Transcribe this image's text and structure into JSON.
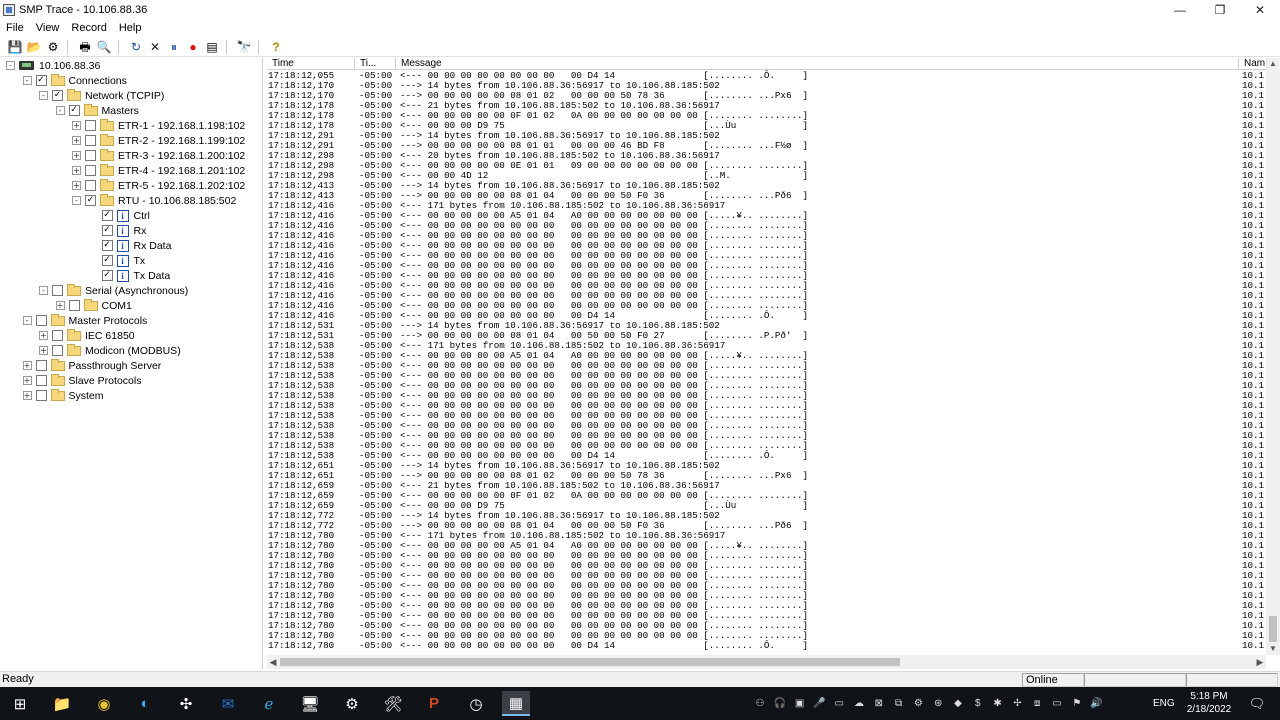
{
  "window": {
    "title": "SMP Trace - 10.106.88.36"
  },
  "menu": [
    "File",
    "View",
    "Record",
    "Help"
  ],
  "toolbar": [
    {
      "name": "save-icon",
      "glyph": "💾"
    },
    {
      "name": "open-icon",
      "glyph": "📂"
    },
    {
      "name": "settings-disabled-icon",
      "glyph": "⚙"
    },
    {
      "sep": true
    },
    {
      "name": "print-icon",
      "glyph": "🖶"
    },
    {
      "name": "print-preview-icon",
      "glyph": "🔍"
    },
    {
      "sep": true
    },
    {
      "name": "refresh-icon",
      "glyph": "↻"
    },
    {
      "name": "clear-icon",
      "glyph": "✕"
    },
    {
      "name": "pause-icon",
      "glyph": "⏸"
    },
    {
      "name": "record-icon",
      "glyph": "●"
    },
    {
      "name": "view-list-icon",
      "glyph": "▤"
    },
    {
      "sep": true
    },
    {
      "name": "find-icon",
      "glyph": "🔭"
    },
    {
      "sep": true
    },
    {
      "name": "help-icon",
      "glyph": "?"
    }
  ],
  "tree": [
    {
      "depth": 0,
      "label": "10.106.88.36",
      "exp": "-",
      "kind": "pc",
      "chk": null
    },
    {
      "depth": 1,
      "label": "Connections",
      "exp": "-",
      "kind": "folder",
      "chk": "✓"
    },
    {
      "depth": 2,
      "label": "Network (TCPIP)",
      "exp": "-",
      "kind": "folder",
      "chk": "✓"
    },
    {
      "depth": 3,
      "label": "Masters",
      "exp": "-",
      "kind": "folder",
      "chk": "✓"
    },
    {
      "depth": 4,
      "label": "ETR-1 - 192.168.1.198:102",
      "exp": "+",
      "kind": "folder",
      "chk": ""
    },
    {
      "depth": 4,
      "label": "ETR-2 - 192.168.1.199:102",
      "exp": "+",
      "kind": "folder",
      "chk": ""
    },
    {
      "depth": 4,
      "label": "ETR-3 - 192.168.1.200:102",
      "exp": "+",
      "kind": "folder",
      "chk": ""
    },
    {
      "depth": 4,
      "label": "ETR-4 - 192.168.1.201:102",
      "exp": "+",
      "kind": "folder",
      "chk": ""
    },
    {
      "depth": 4,
      "label": "ETR-5 - 192.168.1.202:102",
      "exp": "+",
      "kind": "folder",
      "chk": ""
    },
    {
      "depth": 4,
      "label": "RTU - 10.106.88.185:502",
      "exp": "-",
      "kind": "folder",
      "chk": "✓"
    },
    {
      "depth": 5,
      "label": "Ctrl",
      "exp": "",
      "kind": "info",
      "chk": "✓"
    },
    {
      "depth": 5,
      "label": "Rx",
      "exp": "",
      "kind": "info",
      "chk": "✓"
    },
    {
      "depth": 5,
      "label": "Rx Data",
      "exp": "",
      "kind": "info",
      "chk": "✓"
    },
    {
      "depth": 5,
      "label": "Tx",
      "exp": "",
      "kind": "info",
      "chk": "✓"
    },
    {
      "depth": 5,
      "label": "Tx Data",
      "exp": "",
      "kind": "info",
      "chk": "✓"
    },
    {
      "depth": 2,
      "label": "Serial (Asynchronous)",
      "exp": "-",
      "kind": "folder",
      "chk": ""
    },
    {
      "depth": 3,
      "label": "COM1",
      "exp": "+",
      "kind": "folder",
      "chk": ""
    },
    {
      "depth": 1,
      "label": "Master Protocols",
      "exp": "-",
      "kind": "folder",
      "chk": ""
    },
    {
      "depth": 2,
      "label": "IEC 61850",
      "exp": "+",
      "kind": "folder",
      "chk": ""
    },
    {
      "depth": 2,
      "label": "Modicon (MODBUS)",
      "exp": "+",
      "kind": "folder",
      "chk": ""
    },
    {
      "depth": 1,
      "label": "Passthrough Server",
      "exp": "+",
      "kind": "folder",
      "chk": ""
    },
    {
      "depth": 1,
      "label": "Slave Protocols",
      "exp": "+",
      "kind": "folder",
      "chk": ""
    },
    {
      "depth": 1,
      "label": "System",
      "exp": "+",
      "kind": "folder",
      "chk": ""
    }
  ],
  "trace": {
    "columns": [
      "Time",
      "Ti...",
      "Message",
      "Nam"
    ],
    "rows": [
      [
        "17:18:12,055",
        "-05:00",
        "<--- 00 00 00 00 00 00 00 00   00 D4 14                [........ .Ô.     ]",
        "10.1"
      ],
      [
        "17:18:12,170",
        "-05:00",
        "---> 14 bytes from 10.106.88.36:56917 to 10.106.88.185:502",
        "10.1"
      ],
      [
        "17:18:12,170",
        "-05:00",
        "---> 00 00 00 00 00 08 01 02   00 00 00 50 78 36       [........ ...Px6  ]",
        "10.1"
      ],
      [
        "17:18:12,178",
        "-05:00",
        "<--- 21 bytes from 10.106.88.185:502 to 10.106.88.36:56917",
        "10.1"
      ],
      [
        "17:18:12,178",
        "-05:00",
        "<--- 00 00 00 00 00 0F 01 02   0A 00 00 00 00 00 00 00 [........ ........]",
        "10.1"
      ],
      [
        "17:18:12,178",
        "-05:00",
        "<--- 00 00 00 D9 75                                    [...Ùu            ]",
        "10.1"
      ],
      [
        "17:18:12,291",
        "-05:00",
        "---> 14 bytes from 10.106.88.36:56917 to 10.106.88.185:502",
        "10.1"
      ],
      [
        "17:18:12,291",
        "-05:00",
        "---> 00 00 00 00 00 08 01 01   00 00 00 46 BD F8       [........ ...F½ø  ]",
        "10.1"
      ],
      [
        "17:18:12,298",
        "-05:00",
        "<--- 20 bytes from 10.106.88.185:502 to 10.106.88.36:56917",
        "10.1"
      ],
      [
        "17:18:12,298",
        "-05:00",
        "<--- 00 00 00 00 00 0E 01 01   09 00 00 00 00 00 00 00 [........ ........]",
        "10.1"
      ],
      [
        "17:18:12,298",
        "-05:00",
        "<--- 00 00 4D 12                                       [..M.             ]",
        "10.1"
      ],
      [
        "17:18:12,413",
        "-05:00",
        "---> 14 bytes from 10.106.88.36:56917 to 10.106.88.185:502",
        "10.1"
      ],
      [
        "17:18:12,413",
        "-05:00",
        "---> 00 00 00 00 00 08 01 04   00 00 00 50 F0 36       [........ ...Pð6  ]",
        "10.1"
      ],
      [
        "17:18:12,416",
        "-05:00",
        "<--- 171 bytes from 10.106.88.185:502 to 10.106.88.36:56917",
        "10.1"
      ],
      [
        "17:18:12,416",
        "-05:00",
        "<--- 00 00 00 00 00 A5 01 04   A0 00 00 00 00 00 00 00 [.....¥.. ........]",
        "10.1"
      ],
      [
        "17:18:12,416",
        "-05:00",
        "<--- 00 00 00 00 00 00 00 00   00 00 00 00 00 00 00 00 [........ ........]",
        "10.1"
      ],
      [
        "17:18:12,416",
        "-05:00",
        "<--- 00 00 00 00 00 00 00 00   00 00 00 00 00 00 00 00 [........ ........]",
        "10.1"
      ],
      [
        "17:18:12,416",
        "-05:00",
        "<--- 00 00 00 00 00 00 00 00   00 00 00 00 00 00 00 00 [........ ........]",
        "10.1"
      ],
      [
        "17:18:12,416",
        "-05:00",
        "<--- 00 00 00 00 00 00 00 00   00 00 00 00 00 00 00 00 [........ ........]",
        "10.1"
      ],
      [
        "17:18:12,416",
        "-05:00",
        "<--- 00 00 00 00 00 00 00 00   00 00 00 00 00 00 00 00 [........ ........]",
        "10.1"
      ],
      [
        "17:18:12,416",
        "-05:00",
        "<--- 00 00 00 00 00 00 00 00   00 00 00 00 00 00 00 00 [........ ........]",
        "10.1"
      ],
      [
        "17:18:12,416",
        "-05:00",
        "<--- 00 00 00 00 00 00 00 00   00 00 00 00 00 00 00 00 [........ ........]",
        "10.1"
      ],
      [
        "17:18:12,416",
        "-05:00",
        "<--- 00 00 00 00 00 00 00 00   00 00 00 00 00 00 00 00 [........ ........]",
        "10.1"
      ],
      [
        "17:18:12,416",
        "-05:00",
        "<--- 00 00 00 00 00 00 00 00   00 00 00 00 00 00 00 00 [........ ........]",
        "10.1"
      ],
      [
        "17:18:12,416",
        "-05:00",
        "<--- 00 00 00 00 00 00 00 00   00 D4 14                [........ .Ô.     ]",
        "10.1"
      ],
      [
        "17:18:12,531",
        "-05:00",
        "---> 14 bytes from 10.106.88.36:56917 to 10.106.88.185:502",
        "10.1"
      ],
      [
        "17:18:12,531",
        "-05:00",
        "---> 00 00 00 00 00 08 01 04   00 50 00 50 F0 27       [........ .P.Pð'  ]",
        "10.1"
      ],
      [
        "17:18:12,538",
        "-05:00",
        "<--- 171 bytes from 10.106.88.185:502 to 10.106.88.36:56917",
        "10.1"
      ],
      [
        "17:18:12,538",
        "-05:00",
        "<--- 00 00 00 00 00 A5 01 04   A0 00 00 00 00 00 00 00 [.....¥.. ........]",
        "10.1"
      ],
      [
        "17:18:12,538",
        "-05:00",
        "<--- 00 00 00 00 00 00 00 00   00 00 00 00 00 00 00 00 [........ ........]",
        "10.1"
      ],
      [
        "17:18:12,538",
        "-05:00",
        "<--- 00 00 00 00 00 00 00 00   00 00 00 00 00 00 00 00 [........ ........]",
        "10.1"
      ],
      [
        "17:18:12,538",
        "-05:00",
        "<--- 00 00 00 00 00 00 00 00   00 00 00 00 00 00 00 00 [........ ........]",
        "10.1"
      ],
      [
        "17:18:12,538",
        "-05:00",
        "<--- 00 00 00 00 00 00 00 00   00 00 00 00 00 00 00 00 [........ ........]",
        "10.1"
      ],
      [
        "17:18:12,538",
        "-05:00",
        "<--- 00 00 00 00 00 00 00 00   00 00 00 00 00 00 00 00 [........ ........]",
        "10.1"
      ],
      [
        "17:18:12,538",
        "-05:00",
        "<--- 00 00 00 00 00 00 00 00   00 00 00 00 00 00 00 00 [........ ........]",
        "10.1"
      ],
      [
        "17:18:12,538",
        "-05:00",
        "<--- 00 00 00 00 00 00 00 00   00 00 00 00 00 00 00 00 [........ ........]",
        "10.1"
      ],
      [
        "17:18:12,538",
        "-05:00",
        "<--- 00 00 00 00 00 00 00 00   00 00 00 00 00 00 00 00 [........ ........]",
        "10.1"
      ],
      [
        "17:18:12,538",
        "-05:00",
        "<--- 00 00 00 00 00 00 00 00   00 00 00 00 00 00 00 00 [........ ........]",
        "10.1"
      ],
      [
        "17:18:12,538",
        "-05:00",
        "<--- 00 00 00 00 00 00 00 00   00 D4 14                [........ .Ô.     ]",
        "10.1"
      ],
      [
        "17:18:12,651",
        "-05:00",
        "---> 14 bytes from 10.106.88.36:56917 to 10.106.88.185:502",
        "10.1"
      ],
      [
        "17:18:12,651",
        "-05:00",
        "---> 00 00 00 00 00 08 01 02   00 00 00 50 78 36       [........ ...Px6  ]",
        "10.1"
      ],
      [
        "17:18:12,659",
        "-05:00",
        "<--- 21 bytes from 10.106.88.185:502 to 10.106.88.36:56917",
        "10.1"
      ],
      [
        "17:18:12,659",
        "-05:00",
        "<--- 00 00 00 00 00 0F 01 02   0A 00 00 00 00 00 00 00 [........ ........]",
        "10.1"
      ],
      [
        "17:18:12,659",
        "-05:00",
        "<--- 00 00 00 D9 75                                    [...Ùu            ]",
        "10.1"
      ],
      [
        "17:18:12,772",
        "-05:00",
        "---> 14 bytes from 10.106.88.36:56917 to 10.106.88.185:502",
        "10.1"
      ],
      [
        "17:18:12,772",
        "-05:00",
        "---> 00 00 00 00 00 08 01 04   00 00 00 50 F0 36       [........ ...Pð6  ]",
        "10.1"
      ],
      [
        "17:18:12,780",
        "-05:00",
        "<--- 171 bytes from 10.106.88.185:502 to 10.106.88.36:56917",
        "10.1"
      ],
      [
        "17:18:12,780",
        "-05:00",
        "<--- 00 00 00 00 00 A5 01 04   A0 00 00 00 00 00 00 00 [.....¥.. ........]",
        "10.1"
      ],
      [
        "17:18:12,780",
        "-05:00",
        "<--- 00 00 00 00 00 00 00 00   00 00 00 00 00 00 00 00 [........ ........]",
        "10.1"
      ],
      [
        "17:18:12,780",
        "-05:00",
        "<--- 00 00 00 00 00 00 00 00   00 00 00 00 00 00 00 00 [........ ........]",
        "10.1"
      ],
      [
        "17:18:12,780",
        "-05:00",
        "<--- 00 00 00 00 00 00 00 00   00 00 00 00 00 00 00 00 [........ ........]",
        "10.1"
      ],
      [
        "17:18:12,780",
        "-05:00",
        "<--- 00 00 00 00 00 00 00 00   00 00 00 00 00 00 00 00 [........ ........]",
        "10.1"
      ],
      [
        "17:18:12,780",
        "-05:00",
        "<--- 00 00 00 00 00 00 00 00   00 00 00 00 00 00 00 00 [........ ........]",
        "10.1"
      ],
      [
        "17:18:12,780",
        "-05:00",
        "<--- 00 00 00 00 00 00 00 00   00 00 00 00 00 00 00 00 [........ ........]",
        "10.1"
      ],
      [
        "17:18:12,780",
        "-05:00",
        "<--- 00 00 00 00 00 00 00 00   00 00 00 00 00 00 00 00 [........ ........]",
        "10.1"
      ],
      [
        "17:18:12,780",
        "-05:00",
        "<--- 00 00 00 00 00 00 00 00   00 00 00 00 00 00 00 00 [........ ........]",
        "10.1"
      ],
      [
        "17:18:12,780",
        "-05:00",
        "<--- 00 00 00 00 00 00 00 00   00 00 00 00 00 00 00 00 [........ ........]",
        "10.1"
      ],
      [
        "17:18:12,780",
        "-05:00",
        "<--- 00 00 00 00 00 00 00 00   00 D4 14                [........ .Ô.     ]",
        "10.1"
      ]
    ]
  },
  "status": {
    "ready": "Ready",
    "online": "Online"
  },
  "taskbar": {
    "apps": [
      {
        "name": "start-icon",
        "glyph": "⊞"
      },
      {
        "name": "file-explorer-icon",
        "glyph": "📁"
      },
      {
        "name": "chrome-icon",
        "glyph": "◉"
      },
      {
        "name": "edge-icon",
        "glyph": "◐"
      },
      {
        "name": "app-icon-gear-blue",
        "glyph": "✣"
      },
      {
        "name": "outlook-icon",
        "glyph": "✉"
      },
      {
        "name": "internet-explorer-icon",
        "glyph": "ℯ"
      },
      {
        "name": "remote-desktop-icon",
        "glyph": "🖥"
      },
      {
        "name": "settings-icon",
        "glyph": "⚙"
      },
      {
        "name": "config-tool-icon",
        "glyph": "🛠"
      },
      {
        "name": "powerpoint-icon",
        "glyph": "P"
      },
      {
        "name": "clock-app-icon",
        "glyph": "◷"
      },
      {
        "name": "smp-trace-taskbar-icon",
        "glyph": "▦"
      }
    ],
    "tray": [
      "⚇",
      "🎧",
      "▣",
      "🎤",
      "▭",
      "☁",
      "⊠",
      "⧉",
      "⚙",
      "⊛",
      "◆",
      "$",
      "✱",
      "✢",
      "⧈",
      "▭",
      "⚑",
      "🔊"
    ],
    "lang": "ENG",
    "time": "5:18 PM",
    "date": "2/18/2022",
    "notifications_glyph": "🗨"
  }
}
